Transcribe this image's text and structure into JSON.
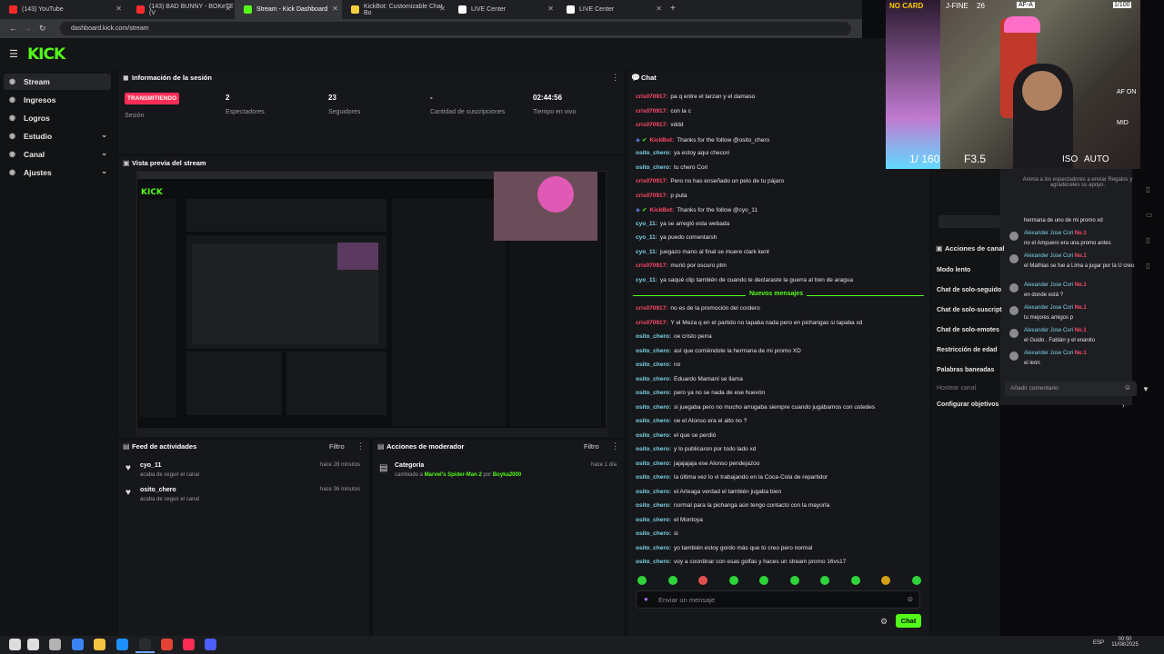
{
  "tabs": [
    {
      "label": "(143) YouTube",
      "color": "#ff2b2b"
    },
    {
      "label": "(143) BAD BUNNY - BOKeTE (V",
      "color": "#ff2b2b"
    },
    {
      "label": "Stream - Kick Dashboard",
      "color": "#53fc18"
    },
    {
      "label": "KickBot: Customizable Chat Bo",
      "color": "#f4d03f"
    },
    {
      "label": "LIVE Center",
      "color": "#ffffff"
    },
    {
      "label": "LIVE Center",
      "color": "#ffffff"
    }
  ],
  "url": "dashboard.kick.com/stream",
  "logo": "KICK",
  "sidebar": [
    {
      "label": "Stream",
      "icon": "broadcast-icon",
      "chev": ""
    },
    {
      "label": "Ingresos",
      "icon": "money-icon",
      "chev": ""
    },
    {
      "label": "Logros",
      "icon": "trophy-icon",
      "chev": ""
    },
    {
      "label": "Estudio",
      "icon": "palette-icon",
      "chev": "⌄"
    },
    {
      "label": "Canal",
      "icon": "channel-icon",
      "chev": "⌄"
    },
    {
      "label": "Ajustes",
      "icon": "gear-icon",
      "chev": "⌄"
    }
  ],
  "session": {
    "title": "Información de la sesión",
    "badge": "TRANSMITIENDO",
    "badge_label": "Sesión",
    "stats": [
      {
        "value": "2",
        "label": "Espectadores"
      },
      {
        "value": "23",
        "label": "Seguidores"
      },
      {
        "value": "-",
        "label": "Cantidad de suscripciones"
      },
      {
        "value": "02:44:56",
        "label": "Tiempo en vivo"
      }
    ]
  },
  "preview": {
    "title": "Vista previa del stream"
  },
  "activity": {
    "title": "Feed de actividades",
    "filter": "Filtro",
    "items": [
      {
        "user": "cyo_11",
        "action": "acaba de seguir el canal",
        "time": "hace 28 minutos"
      },
      {
        "user": "osito_chero",
        "action": "acaba de seguir el canal",
        "time": "hace 36 minutos"
      }
    ]
  },
  "modactions": {
    "title": "Acciones de moderador",
    "filter": "Filtro",
    "items": [
      {
        "title": "Categoría",
        "pre": "cambiado a ",
        "game": "Marvel's Spider-Man 2",
        "mid": " por ",
        "by": "Boyka2000",
        "time": "hace 1 día"
      }
    ]
  },
  "chat": {
    "title": "Chat",
    "new_messages": "Nuevos mensajes",
    "placeholder": "Enviar un mensaje",
    "send": "Chat",
    "messages": [
      {
        "user": "cris070917",
        "c": "ured",
        "text": "pa q entre el tarzan y el damaso"
      },
      {
        "user": "cris070917",
        "c": "ured",
        "text": "con la c"
      },
      {
        "user": "cris070917",
        "c": "ured",
        "text": "xddd"
      },
      {
        "user": "KickBot",
        "c": "ured",
        "text": "Thanks for the follow @osito_chero",
        "bot": true
      },
      {
        "user": "osito_chero",
        "c": "ucyan",
        "text": "ya estoy aqui checori"
      },
      {
        "user": "osito_chero",
        "c": "ucyan",
        "text": "tu chero Cori"
      },
      {
        "user": "cris070917",
        "c": "ured",
        "text": "Pero no has enseñado un pelo de tu pájaro"
      },
      {
        "user": "cris070917",
        "c": "ured",
        "text": "p puta"
      },
      {
        "user": "KickBot",
        "c": "ured",
        "text": "Thanks for the follow @cyo_11",
        "bot": true
      },
      {
        "user": "cyo_11",
        "c": "ucyan",
        "text": "ya se arregló esta webada"
      },
      {
        "user": "cyo_11",
        "c": "ucyan",
        "text": "ya puedo comentarsh"
      },
      {
        "user": "cyo_11",
        "c": "ucyan",
        "text": "juegazo mano al final se muere clark kent"
      },
      {
        "user": "cris070917",
        "c": "ured",
        "text": "murió por oscuro ptm"
      },
      {
        "user": "cyo_11",
        "c": "ucyan",
        "text": "ya saqué clip también de cuando le declaraste la guerra al tren de aragua"
      },
      {
        "user": "cris070917",
        "c": "ured",
        "text": "no es de la promoción del cordero"
      },
      {
        "user": "cris070917",
        "c": "ured",
        "text": "Y el Meza q en el partido no tapaba nada pero en pichangas si tapaba xd"
      },
      {
        "user": "osito_chero",
        "c": "ucyan",
        "text": "oe cristo perra"
      },
      {
        "user": "osito_chero",
        "c": "ucyan",
        "text": "así que comiéndote la hermana de mi promo XD"
      },
      {
        "user": "osito_chero",
        "c": "ucyan",
        "text": "no"
      },
      {
        "user": "osito_chero",
        "c": "ucyan",
        "text": "Eduardo Mamaní se llama"
      },
      {
        "user": "osito_chero",
        "c": "ucyan",
        "text": "pero ya no se nada de ese huevón"
      },
      {
        "user": "osito_chero",
        "c": "ucyan",
        "text": "si juegaba pero no mucho arrugaba siempre cuando jugábamos con ustedes"
      },
      {
        "user": "osito_chero",
        "c": "ucyan",
        "text": "oe el Alonso era el alto no ?"
      },
      {
        "user": "osito_chero",
        "c": "ucyan",
        "text": "el que se perdió"
      },
      {
        "user": "osito_chero",
        "c": "ucyan",
        "text": "y lo publicaron por todo lado xd"
      },
      {
        "user": "osito_chero",
        "c": "ucyan",
        "text": "jajajajaja ese Alonso pendejazoo"
      },
      {
        "user": "osito_chero",
        "c": "ucyan",
        "text": "la última vez lo vi trabajando en la Coca-Cola de repartidor"
      },
      {
        "user": "osito_chero",
        "c": "ucyan",
        "text": "el Arteaga verdad el también jugaba bien"
      },
      {
        "user": "osito_chero",
        "c": "ucyan",
        "text": "normal para la pichanga aún tengo contacto con la mayoría"
      },
      {
        "user": "osito_chero",
        "c": "ucyan",
        "text": "el Montoya"
      },
      {
        "user": "osito_chero",
        "c": "ucyan",
        "text": "si"
      },
      {
        "user": "osito_chero",
        "c": "ucyan",
        "text": "yo también estoy gordo más que tú creo pero normal"
      },
      {
        "user": "osito_chero",
        "c": "ucyan",
        "text": "voy a coordinar con esas golfas y haces un stream promo 16vs17"
      }
    ]
  },
  "right": {
    "promo": "Anima a los espectadores a enviar Regalos y agradéceles su apoyo.",
    "actions_title": "Acciones de canal",
    "actions": [
      "Modo lento",
      "Chat de solo-seguido",
      "Chat de solo-suscript",
      "Chat de solo-emotes",
      "Restricción de edad",
      "Palabras baneadas",
      "Hostear canal",
      "Configurar objetivos"
    ],
    "overlay_msgs": [
      {
        "user": "",
        "badge": "",
        "text": "hermana de uno de mi promo xd"
      },
      {
        "user": "Alexander Jose Cori",
        "badge": "No.1",
        "text": "no el Ampuero era una promo antes"
      },
      {
        "user": "Alexander Jose Cori",
        "badge": "No.1",
        "text": "el Mathias se fue a Lima a jugar por la U creo"
      },
      {
        "user": "Alexander Jose Cori",
        "badge": "No.1",
        "text": "en donde está ?"
      },
      {
        "user": "Alexander Jose Cori",
        "badge": "No.1",
        "text": "tu mejores amigos p"
      },
      {
        "user": "Alexander Jose Cori",
        "badge": "No.1",
        "text": "el Guido , Fabián y el enanito"
      },
      {
        "user": "Alexander Jose Cori",
        "badge": "No.1",
        "text": "el león"
      }
    ],
    "comment_placeholder": "Añadir comentario"
  },
  "camera": {
    "top_left": "NO CARD",
    "top_mid": "J-FINE",
    "top_num": "26",
    "top_right": "AF-A",
    "top_far": "1/100",
    "shutter": "1/ 160",
    "fstop": "F3.5",
    "iso": "ISO",
    "iso_val": "AUTO",
    "af": "AF ON",
    "mid": "MID"
  },
  "clock": {
    "time": "00:50",
    "date": "11/08/2025",
    "lang": "ESP"
  }
}
